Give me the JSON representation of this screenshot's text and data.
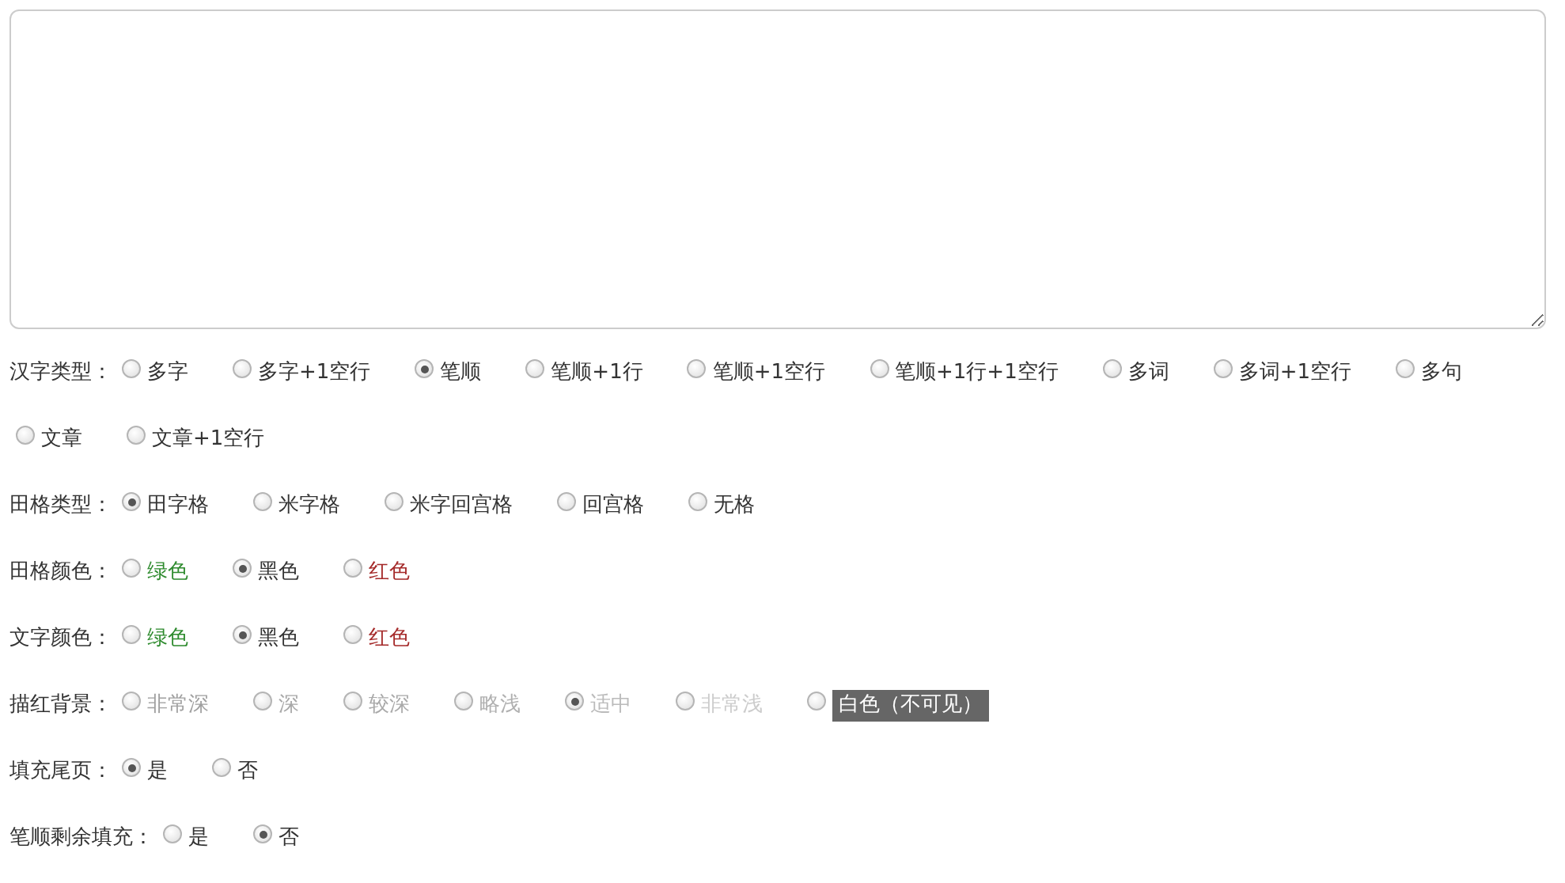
{
  "groups": [
    {
      "label": "汉字类型：",
      "options": [
        {
          "text": "多字",
          "selected": false,
          "color": "#333333",
          "kind": "text"
        },
        {
          "text": "多字+1空行",
          "selected": false,
          "color": "#333333",
          "kind": "text"
        },
        {
          "text": "笔顺",
          "selected": true,
          "color": "#333333",
          "kind": "text"
        },
        {
          "text": "笔顺+1行",
          "selected": false,
          "color": "#333333",
          "kind": "text"
        },
        {
          "text": "笔顺+1空行",
          "selected": false,
          "color": "#333333",
          "kind": "text"
        },
        {
          "text": "笔顺+1行+1空行",
          "selected": false,
          "color": "#333333",
          "kind": "text"
        },
        {
          "text": "多词",
          "selected": false,
          "color": "#333333",
          "kind": "text"
        },
        {
          "text": "多词+1空行",
          "selected": false,
          "color": "#333333",
          "kind": "text"
        },
        {
          "text": "多句",
          "selected": false,
          "color": "#333333",
          "kind": "text"
        },
        {
          "text": "文章",
          "selected": false,
          "color": "#333333",
          "kind": "text"
        },
        {
          "text": "文章+1空行",
          "selected": false,
          "color": "#333333",
          "kind": "text"
        }
      ]
    },
    {
      "label": "田格类型：",
      "options": [
        {
          "text": "田字格",
          "selected": true,
          "color": "#333333",
          "kind": "text"
        },
        {
          "text": "米字格",
          "selected": false,
          "color": "#333333",
          "kind": "text"
        },
        {
          "text": "米字回宫格",
          "selected": false,
          "color": "#333333",
          "kind": "text"
        },
        {
          "text": "回宫格",
          "selected": false,
          "color": "#333333",
          "kind": "text"
        },
        {
          "text": "无格",
          "selected": false,
          "color": "#333333",
          "kind": "text"
        }
      ]
    },
    {
      "label": "田格颜色：",
      "options": [
        {
          "text": "绿色",
          "selected": false,
          "color": "#2e8b2e",
          "kind": "text"
        },
        {
          "text": "黑色",
          "selected": true,
          "color": "#333333",
          "kind": "text"
        },
        {
          "text": "红色",
          "selected": false,
          "color": "#a52a2a",
          "kind": "text"
        }
      ]
    },
    {
      "label": "文字颜色：",
      "options": [
        {
          "text": "绿色",
          "selected": false,
          "color": "#2e8b2e",
          "kind": "text"
        },
        {
          "text": "黑色",
          "selected": true,
          "color": "#333333",
          "kind": "text"
        },
        {
          "text": "红色",
          "selected": false,
          "color": "#a52a2a",
          "kind": "text"
        }
      ]
    },
    {
      "label": "描红背景：",
      "options": [
        {
          "text": "非常深",
          "selected": false,
          "color": "#a0a0a0",
          "kind": "text"
        },
        {
          "text": "深",
          "selected": false,
          "color": "#a8a8a8",
          "kind": "text"
        },
        {
          "text": "较深",
          "selected": false,
          "color": "#aaaaaa",
          "kind": "text"
        },
        {
          "text": "略浅",
          "selected": false,
          "color": "#b0b0b0",
          "kind": "text"
        },
        {
          "text": "适中",
          "selected": true,
          "color": "#bbbbbb",
          "kind": "text"
        },
        {
          "text": "非常浅",
          "selected": false,
          "color": "#cccccc",
          "kind": "text"
        },
        {
          "text": "白色（不可见）",
          "selected": false,
          "color": "#666666",
          "kind": "boxed"
        }
      ]
    },
    {
      "label": "填充尾页：",
      "options": [
        {
          "text": "是",
          "selected": true,
          "color": "#333333",
          "kind": "text"
        },
        {
          "text": "否",
          "selected": false,
          "color": "#333333",
          "kind": "text"
        }
      ]
    },
    {
      "label": "笔顺剩余填充：",
      "options": [
        {
          "text": "是",
          "selected": false,
          "color": "#333333",
          "kind": "text"
        },
        {
          "text": "否",
          "selected": true,
          "color": "#333333",
          "kind": "text"
        }
      ]
    }
  ]
}
